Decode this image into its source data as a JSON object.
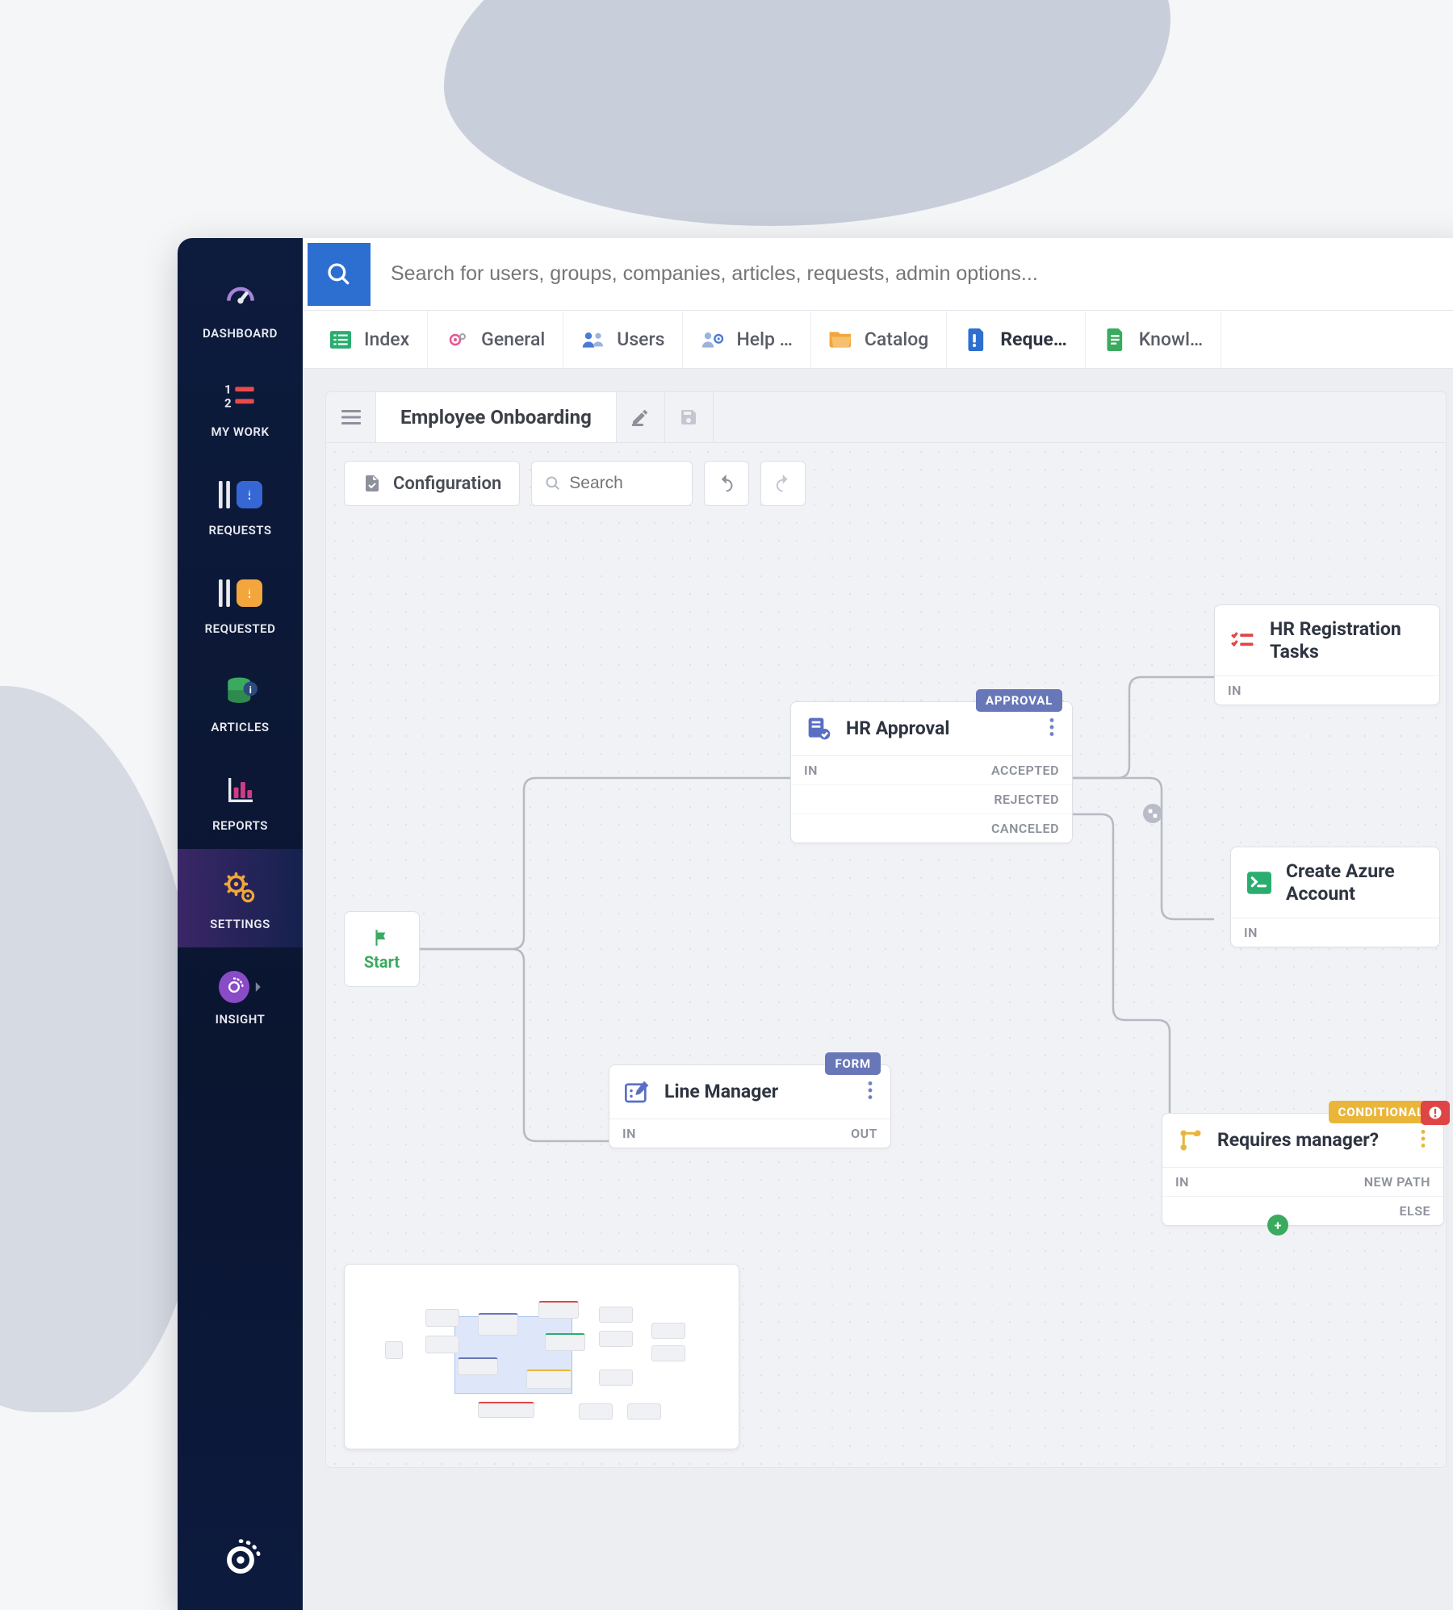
{
  "sidebar": {
    "items": [
      {
        "label": "DASHBOARD"
      },
      {
        "label": "MY WORK"
      },
      {
        "label": "REQUESTS"
      },
      {
        "label": "REQUESTED"
      },
      {
        "label": "ARTICLES"
      },
      {
        "label": "REPORTS"
      },
      {
        "label": "SETTINGS"
      },
      {
        "label": "INSIGHT"
      }
    ]
  },
  "search": {
    "placeholder": "Search for users, groups, companies, articles, requests, admin options..."
  },
  "tabs": [
    {
      "label": "Index"
    },
    {
      "label": "General"
    },
    {
      "label": "Users"
    },
    {
      "label": "Help …"
    },
    {
      "label": "Catalog"
    },
    {
      "label": "Reque…"
    },
    {
      "label": "Knowl…"
    }
  ],
  "workflow": {
    "title": "Employee Onboarding",
    "config_label": "Configuration",
    "search_placeholder": "Search",
    "start_label": "Start",
    "nodes": {
      "hr_approval": {
        "title": "HR Approval",
        "badge": "APPROVAL",
        "port_in": "IN",
        "port_accepted": "ACCEPTED",
        "port_rejected": "REJECTED",
        "port_canceled": "CANCELED"
      },
      "line_manager": {
        "title": "Line Manager",
        "badge": "FORM",
        "port_in": "IN",
        "port_out": "OUT"
      },
      "hr_registration": {
        "title": "HR Registration Tasks",
        "port_in": "IN"
      },
      "create_azure": {
        "title": "Create Azure Account",
        "port_in": "IN"
      },
      "requires_manager": {
        "title": "Requires manager?",
        "badge": "CONDITIONAL",
        "port_in": "IN",
        "port_new_path": "NEW PATH",
        "port_else": "ELSE"
      }
    }
  }
}
